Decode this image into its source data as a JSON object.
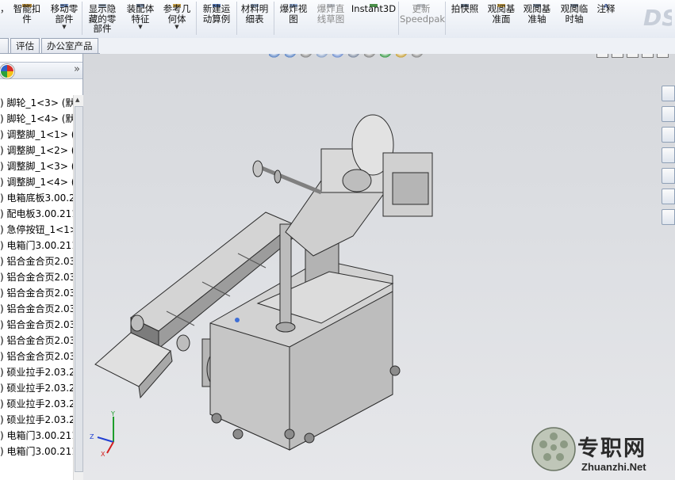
{
  "ribbon": {
    "buttons": [
      {
        "id": "partial",
        "label": "，",
        "grey": false
      },
      {
        "id": "smart-fastener",
        "label": "智能扣\n件",
        "grey": false
      },
      {
        "id": "move-component",
        "label": "移动零\n部件",
        "grey": false
      },
      {
        "id": "show-hidden",
        "label": "显示隐\n藏的零\n部件",
        "grey": false
      },
      {
        "id": "assembly-feature",
        "label": "装配体\n特征",
        "grey": false
      },
      {
        "id": "ref-geometry",
        "label": "参考几\n何体",
        "grey": false
      },
      {
        "id": "new-motion-study",
        "label": "新建运\n动算例",
        "grey": false
      },
      {
        "id": "bom",
        "label": "材料明\n细表",
        "grey": false
      },
      {
        "id": "exploded-view",
        "label": "爆炸视\n图",
        "grey": false
      },
      {
        "id": "explode-line",
        "label": "爆炸直\n线草图",
        "grey": true
      },
      {
        "id": "instant3d",
        "label": "Instant3D",
        "grey": false
      },
      {
        "id": "speedpak",
        "label": "更新\nSpeedpak",
        "grey": true
      },
      {
        "id": "snapshot",
        "label": "拍快照",
        "grey": false
      },
      {
        "id": "ref-plane",
        "label": "观阅基\n准面",
        "grey": false
      },
      {
        "id": "ref-axis",
        "label": "观阅基\n准轴",
        "grey": false
      },
      {
        "id": "temp-axis",
        "label": "观阅临\n时轴",
        "grey": false
      },
      {
        "id": "annotation",
        "label": "注释",
        "grey": false
      }
    ]
  },
  "tabs": [
    "",
    "评估",
    "办公室产品"
  ],
  "tree": {
    "items": [
      ") 脚轮_1<3> (默",
      ") 脚轮_1<4> (默",
      ") 调整脚_1<1> (",
      ") 调整脚_1<2> (",
      ") 调整脚_1<3> (",
      ") 调整脚_1<4> (",
      ") 电箱底板3.00.2",
      ") 配电板3.00.211",
      ") 急停按钮_1<1>",
      ") 电箱门3.00.211",
      ") 铝合金合页2.03.",
      ") 铝合金合页2.03",
      ") 铝合金合页2.03",
      ") 铝合金合页2.03",
      ") 铝合金合页2.03",
      ") 铝合金合页2.03",
      ") 铝合金合页2.03",
      ") 硕业拉手2.03.2",
      ") 硕业拉手2.03.2",
      ") 硕业拉手2.03.2",
      ") 硕业拉手2.03.2",
      ") 电箱门3.00.211",
      ") 电箱门3.00.211"
    ]
  },
  "panel": {
    "expand_glyph": "»"
  },
  "window_controls": [
    "◫",
    "◰",
    "—",
    "❐",
    "✕"
  ],
  "triad": {
    "y": "Y",
    "z": "Z",
    "x": "X"
  },
  "watermark": {
    "text": "专职网",
    "url": "Zhuanzhi.Net"
  },
  "colors": {
    "viewport_bg": "#d9dbdf",
    "ribbon_bg": "#eef1f6",
    "model_gray": "#c9c9c9",
    "model_edge": "#2b2b2b",
    "axis_x": "#d21f1f",
    "axis_y": "#1f9e2c",
    "axis_z": "#1f3ed2"
  }
}
